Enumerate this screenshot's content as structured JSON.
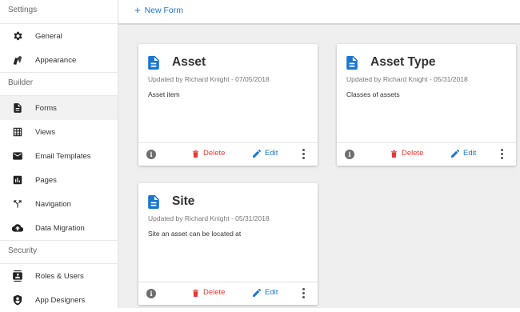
{
  "sidebar": {
    "sections": [
      {
        "title": "Settings",
        "items": [
          {
            "label": "General",
            "icon": "gear-icon"
          },
          {
            "label": "Appearance",
            "icon": "appearance-icon"
          }
        ]
      },
      {
        "title": "Builder",
        "items": [
          {
            "label": "Forms",
            "icon": "document-icon",
            "active": true
          },
          {
            "label": "Views",
            "icon": "grid-icon"
          },
          {
            "label": "Email Templates",
            "icon": "mail-icon"
          },
          {
            "label": "Pages",
            "icon": "chart-icon"
          },
          {
            "label": "Navigation",
            "icon": "fork-icon"
          },
          {
            "label": "Data Migration",
            "icon": "cloud-upload-icon"
          }
        ]
      },
      {
        "title": "Security",
        "items": [
          {
            "label": "Roles & Users",
            "icon": "contacts-icon"
          },
          {
            "label": "App Designers",
            "icon": "shield-icon"
          }
        ]
      }
    ]
  },
  "toolbar": {
    "new_form_label": "New Form",
    "new_form_icon": "plus-icon"
  },
  "cards": [
    {
      "title": "Asset",
      "updated": "Updated by Richard Knight - 07/05/2018",
      "description": "Asset item",
      "delete_label": "Delete",
      "edit_label": "Edit"
    },
    {
      "title": "Asset Type",
      "updated": "Updated by Richard Knight - 05/31/2018",
      "description": "Classes of assets",
      "delete_label": "Delete",
      "edit_label": "Edit"
    },
    {
      "title": "Site",
      "updated": "Updated by Richard Knight - 05/31/2018",
      "description": "Site an asset can be located at",
      "delete_label": "Delete",
      "edit_label": "Edit"
    }
  ],
  "colors": {
    "accent": "#1976d2",
    "danger": "#e53935",
    "background": "#efefef"
  }
}
